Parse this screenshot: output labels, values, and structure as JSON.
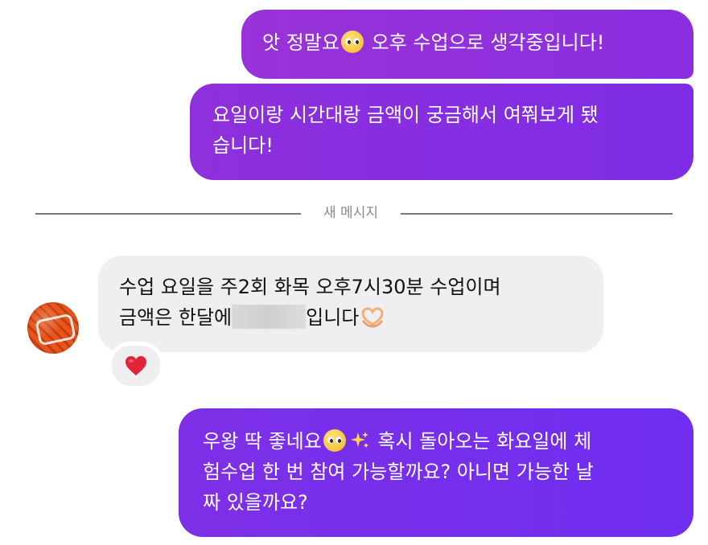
{
  "thread": {
    "messages": [
      {
        "direction": "outgoing",
        "line1_before_emoji": "앗 정말요",
        "emoji": "pleading-face",
        "line1_after_emoji": " 오후 수업으로 생각중입니다!"
      },
      {
        "direction": "outgoing",
        "line1": "요일이랑 시간대랑 금액이 궁금해서 여쭤보게 됐",
        "line2": "습니다!"
      },
      {
        "direction": "incoming",
        "line1": "수업 요일을 주2회 화목 오후7시30분 수업이며",
        "line2_before_redaction": "금액은 한달에",
        "line2_after_redaction": "입니다",
        "emoji": "heart-hands",
        "reaction": "red-heart"
      },
      {
        "direction": "outgoing",
        "line1_before_emoji": "우왕 딱 좋네요",
        "emoji1": "pleading-face",
        "emoji2": "sparkles",
        "line1_after_emoji": " 혹시 돌아오는 화요일에 체",
        "line2": "험수업 한 번 참여 가능할까요? 아니면 가능한 날",
        "line3": "짜 있을까요?"
      }
    ],
    "divider_label": "새 메시지"
  },
  "colors": {
    "outgoing_bubble_start": "#9932d8",
    "outgoing_bubble_end": "#6f2ef0",
    "incoming_bubble": "#efeff1",
    "divider_line": "#7a7a7a",
    "divider_text": "#8a8a8a",
    "reaction_heart": "#e0243a"
  }
}
